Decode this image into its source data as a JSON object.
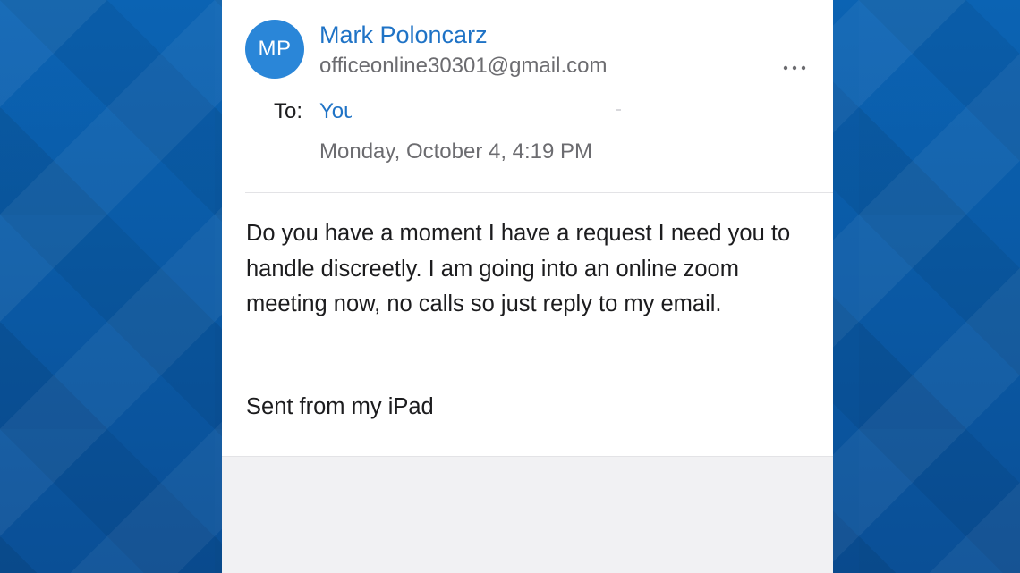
{
  "message": {
    "sender": {
      "initials": "MP",
      "name": "Mark Poloncarz",
      "email": "officeonline30301@gmail.com"
    },
    "to_label": "To:",
    "to_value": "You",
    "date": "Monday, October 4, 4:19 PM",
    "body": "Do you have a moment I have a request I need you to handle discreetly. I am going into an online zoom meeting now, no calls so just reply to my email.",
    "signature": "Sent from my iPad"
  },
  "icons": {
    "more": "more-horizontal-icon"
  },
  "colors": {
    "background": "#0a5aa6",
    "avatar": "#2a86d8",
    "link": "#1f73c6",
    "secondary_text": "#6c6c70",
    "text": "#1c1c1e"
  }
}
